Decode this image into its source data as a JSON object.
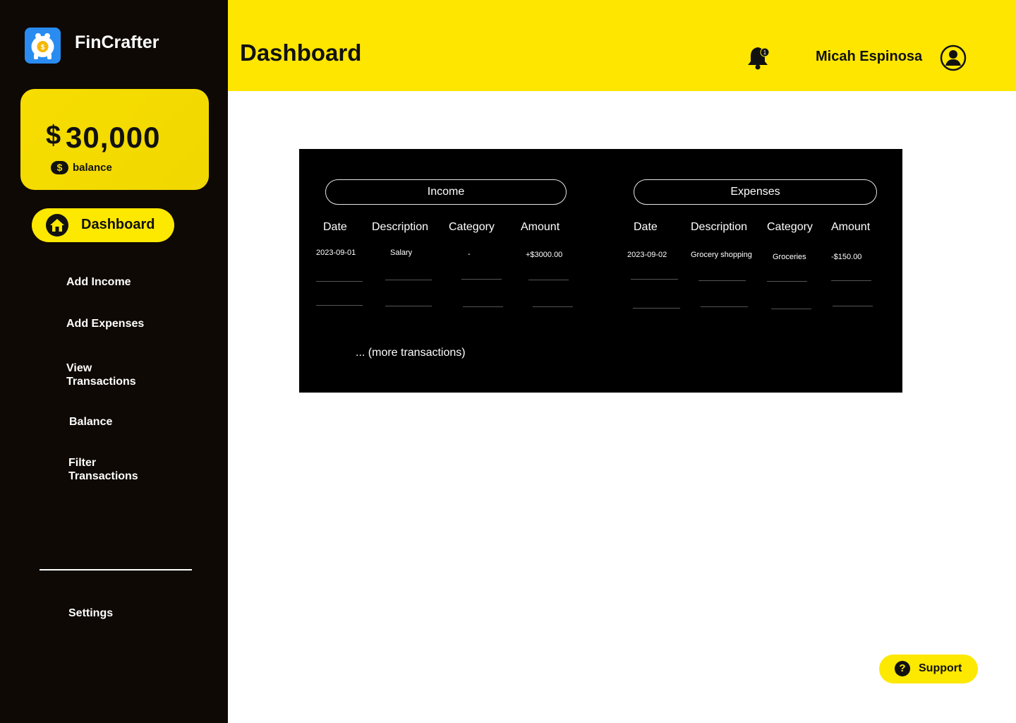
{
  "app": {
    "name": "FinCrafter"
  },
  "balance": {
    "currency_symbol": "$",
    "amount": "30,000",
    "label": "balance",
    "coin_symbol": "$"
  },
  "nav": {
    "active_label": "Dashboard",
    "items": [
      {
        "label": "Add Income"
      },
      {
        "label": "Add Expenses"
      },
      {
        "label": "View Transactions"
      },
      {
        "label": "Balance"
      },
      {
        "label": "Filter Transactions"
      }
    ],
    "settings_label": "Settings"
  },
  "header": {
    "title": "Dashboard",
    "notification_count": "1",
    "user_name": "Micah Espinosa"
  },
  "income": {
    "title": "Income",
    "columns": [
      "Date",
      "Description",
      "Category",
      "Amount"
    ],
    "rows": [
      {
        "date": "2023-09-01",
        "description": "Salary",
        "category": "-",
        "amount": "+$3000.00"
      }
    ]
  },
  "expenses": {
    "title": "Expenses",
    "columns": [
      "Date",
      "Description",
      "Category",
      "Amount"
    ],
    "rows": [
      {
        "date": "2023-09-02",
        "description": "Grocery shopping",
        "category": "Groceries",
        "amount": "-$150.00"
      }
    ]
  },
  "more_text": "... (more transactions)",
  "support": {
    "label": "Support",
    "icon_glyph": "?"
  },
  "colors": {
    "sidebar_bg": "#0e0904",
    "accent_yellow": "#fee600",
    "panel_bg": "#000000",
    "logo_blue": "#2a8cf0"
  },
  "icons": {
    "logo": "piggy-bank-icon",
    "home": "home-icon",
    "bell": "bell-icon",
    "user": "user-circle-icon",
    "support": "question-icon"
  }
}
